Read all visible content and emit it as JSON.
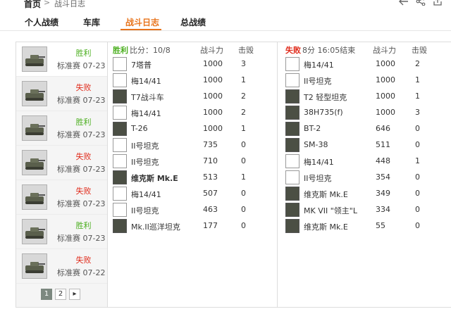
{
  "breadcrumb": {
    "home": "首页",
    "sep": ">",
    "current": "战斗日志"
  },
  "top_icons": [
    "back-arrow-icon",
    "share-icon",
    "export-icon"
  ],
  "tabs": [
    {
      "label": "个人战绩",
      "active": false
    },
    {
      "label": "车库",
      "active": false
    },
    {
      "label": "战斗日志",
      "active": true
    },
    {
      "label": "总战绩",
      "active": false
    }
  ],
  "battles": [
    {
      "result": "胜利",
      "outcome": "win",
      "mode": "标准赛 07-23",
      "selected": true
    },
    {
      "result": "失败",
      "outcome": "lose",
      "mode": "标准赛 07-23",
      "selected": false
    },
    {
      "result": "胜利",
      "outcome": "win",
      "mode": "标准赛 07-23",
      "selected": false
    },
    {
      "result": "失败",
      "outcome": "lose",
      "mode": "标准赛 07-23",
      "selected": false
    },
    {
      "result": "失败",
      "outcome": "lose",
      "mode": "标准赛 07-23",
      "selected": false
    },
    {
      "result": "胜利",
      "outcome": "win",
      "mode": "标准赛 07-23",
      "selected": false
    },
    {
      "result": "失败",
      "outcome": "lose",
      "mode": "标准赛 07-22",
      "selected": false
    }
  ],
  "pagination": {
    "pages": [
      "1",
      "2"
    ],
    "active": "1",
    "next": "▸"
  },
  "team_left": {
    "result": "胜利",
    "meta": "比分：10/8",
    "power_header": "战斗力",
    "kills_header": "击毁",
    "players": [
      {
        "name": "7塔普",
        "power": "1000",
        "kills": "3",
        "tank_icon": false,
        "bold": false
      },
      {
        "name": "梅14/41",
        "power": "1000",
        "kills": "1",
        "tank_icon": false,
        "bold": false
      },
      {
        "name": "T7战斗车",
        "power": "1000",
        "kills": "2",
        "tank_icon": true,
        "bold": false
      },
      {
        "name": "梅14/41",
        "power": "1000",
        "kills": "2",
        "tank_icon": false,
        "bold": false
      },
      {
        "name": "T-26",
        "power": "1000",
        "kills": "1",
        "tank_icon": true,
        "bold": false
      },
      {
        "name": "II号坦克",
        "power": "735",
        "kills": "0",
        "tank_icon": false,
        "bold": false
      },
      {
        "name": "II号坦克",
        "power": "710",
        "kills": "0",
        "tank_icon": false,
        "bold": false
      },
      {
        "name": "维克斯 Mk.E",
        "power": "513",
        "kills": "1",
        "tank_icon": true,
        "bold": true
      },
      {
        "name": "梅14/41",
        "power": "507",
        "kills": "0",
        "tank_icon": false,
        "bold": false
      },
      {
        "name": "II号坦克",
        "power": "463",
        "kills": "0",
        "tank_icon": false,
        "bold": false
      },
      {
        "name": "Mk.II巡洋坦克",
        "power": "177",
        "kills": "0",
        "tank_icon": true,
        "bold": false
      }
    ]
  },
  "team_right": {
    "result": "失败",
    "meta": "8分 16:05结束",
    "power_header": "战斗力",
    "kills_header": "击毁",
    "players": [
      {
        "name": "梅14/41",
        "power": "1000",
        "kills": "2",
        "tank_icon": false,
        "bold": false
      },
      {
        "name": "II号坦克",
        "power": "1000",
        "kills": "1",
        "tank_icon": false,
        "bold": false
      },
      {
        "name": "T2 轻型坦克",
        "power": "1000",
        "kills": "1",
        "tank_icon": true,
        "bold": false
      },
      {
        "name": "38H735(f)",
        "power": "1000",
        "kills": "3",
        "tank_icon": true,
        "bold": false
      },
      {
        "name": "BT-2",
        "power": "646",
        "kills": "0",
        "tank_icon": true,
        "bold": false
      },
      {
        "name": "SM-38",
        "power": "511",
        "kills": "0",
        "tank_icon": true,
        "bold": false
      },
      {
        "name": "梅14/41",
        "power": "448",
        "kills": "1",
        "tank_icon": false,
        "bold": false
      },
      {
        "name": "II号坦克",
        "power": "354",
        "kills": "0",
        "tank_icon": false,
        "bold": false
      },
      {
        "name": "维克斯 Mk.E",
        "power": "349",
        "kills": "0",
        "tank_icon": true,
        "bold": false
      },
      {
        "name": "MK VII \"领主\"L",
        "power": "334",
        "kills": "0",
        "tank_icon": true,
        "bold": false
      },
      {
        "name": "维克斯 Mk.E",
        "power": "55",
        "kills": "0",
        "tank_icon": true,
        "bold": false
      }
    ]
  },
  "colors": {
    "accent": "#e8741c",
    "win": "#4caf20",
    "lose": "#e02a1a"
  }
}
